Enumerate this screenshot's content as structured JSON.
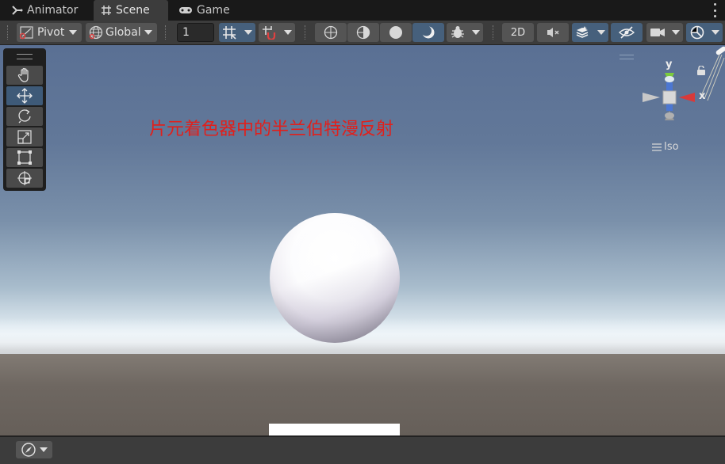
{
  "tabs": [
    {
      "label": "Animator",
      "icon": "animator-icon",
      "active": false
    },
    {
      "label": "Scene",
      "icon": "grid-hash-icon",
      "active": true
    },
    {
      "label": "Game",
      "icon": "gamepad-icon",
      "active": false
    }
  ],
  "toolbar": {
    "pivot_label": "Pivot",
    "global_label": "Global",
    "grid_snap_value": "1",
    "mode_2d_label": "2D"
  },
  "annotation": {
    "text": "片元着色器中的半兰伯特漫反射",
    "color": "#e0201c"
  },
  "gizmo": {
    "y_label": "y",
    "x_label": "x",
    "projection_label": "Iso"
  },
  "colors": {
    "accent_selected": "#46607c",
    "gizmo_y": "#7ccc3c",
    "gizmo_x": "#d83a3a",
    "gizmo_z": "#4a78d8"
  }
}
